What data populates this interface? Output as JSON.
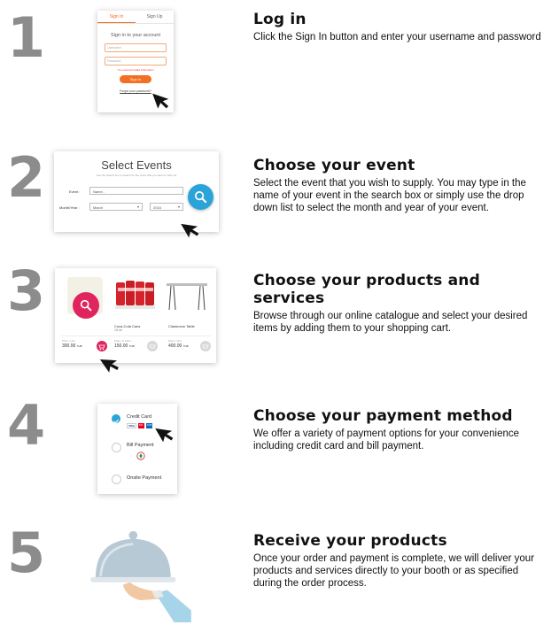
{
  "steps": [
    {
      "num": "1",
      "title": "Log in",
      "desc": "Click the Sign In button and enter your username and password"
    },
    {
      "num": "2",
      "title": "Choose your event",
      "desc": "Select the event that you wish to supply. You may type in the name of your event in the search box or simply use the drop down list to select the month and year of your event."
    },
    {
      "num": "3",
      "title": "Choose your products and services",
      "desc": "Browse through our online catalogue and select your desired items by adding them to your shopping cart."
    },
    {
      "num": "4",
      "title": "Choose your payment method",
      "desc": "We offer a variety of payment options for your convenience including credit card and bill payment."
    },
    {
      "num": "5",
      "title": "Receive your products",
      "desc": "Once your order and payment is complete, we will deliver your products and services directly to your booth or as specified during the order process."
    }
  ],
  "login": {
    "tab_signin": "Sign In",
    "tab_signup": "Sign Up",
    "heading": "Sign in to your account",
    "username_placeholder": "Username",
    "password_placeholder": "Password",
    "error": "You entered invalid information",
    "button": "Sign In",
    "forgot": "Forgot your password?"
  },
  "events": {
    "title": "Select Events",
    "subtitle": "Use the search box to search for the event that you want to order for",
    "event_label": "Event :",
    "event_placeholder": "Name..",
    "month_label": "Month/Year :",
    "month_value": "March",
    "year_value": "2015"
  },
  "products": {
    "items": [
      {
        "name": "",
        "price_label": "Price / Unit",
        "price": "300.00",
        "unit": "THB"
      },
      {
        "name": "Coca-Cola Cans",
        "sub": "15 ml",
        "price_label": "Price / 6 Cans",
        "price": "150.00",
        "unit": "THB"
      },
      {
        "name": "Classroom Table",
        "sub": "",
        "price_label": "Price / Unit",
        "price": "400.00",
        "unit": "THB"
      }
    ]
  },
  "payment": {
    "options": [
      {
        "label": "Credit Card",
        "selected": true
      },
      {
        "label": "Bill Payment",
        "selected": false
      },
      {
        "label": "Onsite Payment",
        "selected": false
      }
    ],
    "card_logos": [
      "VISA",
      "MC",
      "JCB"
    ]
  },
  "colors": {
    "accent": "#f36f21",
    "blue": "#2aa3d9",
    "red": "#e0245e",
    "number": "#8c8c8c"
  }
}
